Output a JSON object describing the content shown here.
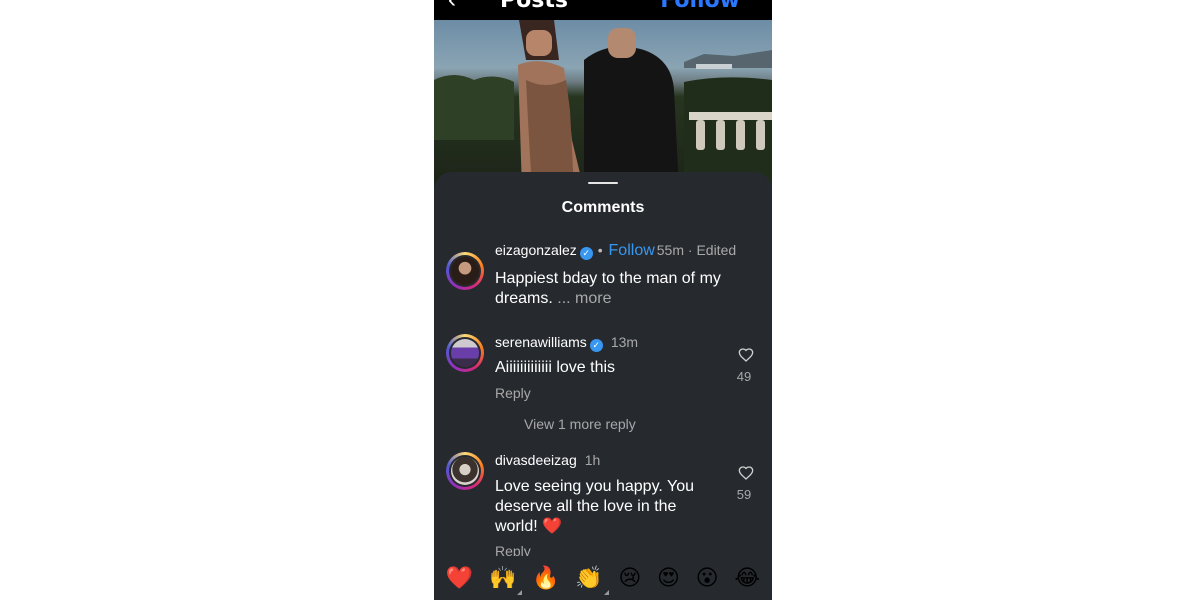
{
  "header": {
    "back_icon": "back-arrow-icon",
    "title": "Posts",
    "follow_label": "Follow"
  },
  "sheet": {
    "title": "Comments"
  },
  "comments": [
    {
      "username": "eizagonzalez",
      "verified": true,
      "follow_label": "Follow",
      "time": "55m · Edited",
      "text": "Happiest bday to the man of my dreams.",
      "more_label": "... more"
    },
    {
      "username": "serenawilliams",
      "verified": true,
      "time": "13m",
      "text": "Aiiiiiiiiiiiii love this",
      "reply_label": "Reply",
      "likes": "49"
    },
    {
      "username": "divasdeeizag",
      "verified": false,
      "time": "1h",
      "text": "Love seeing you happy. You deserve all the love in the world! ❤️",
      "reply_label": "Reply",
      "likes": "59"
    }
  ],
  "view_more_replies": "View 1 more reply",
  "reactions": [
    "❤️",
    "🙌",
    "🔥",
    "👏",
    "😢",
    "😍",
    "😮",
    "😂"
  ],
  "colors": {
    "sheet_bg": "#262a2f",
    "accent_blue": "#3897f0",
    "muted_text": "#a8a8a8"
  }
}
